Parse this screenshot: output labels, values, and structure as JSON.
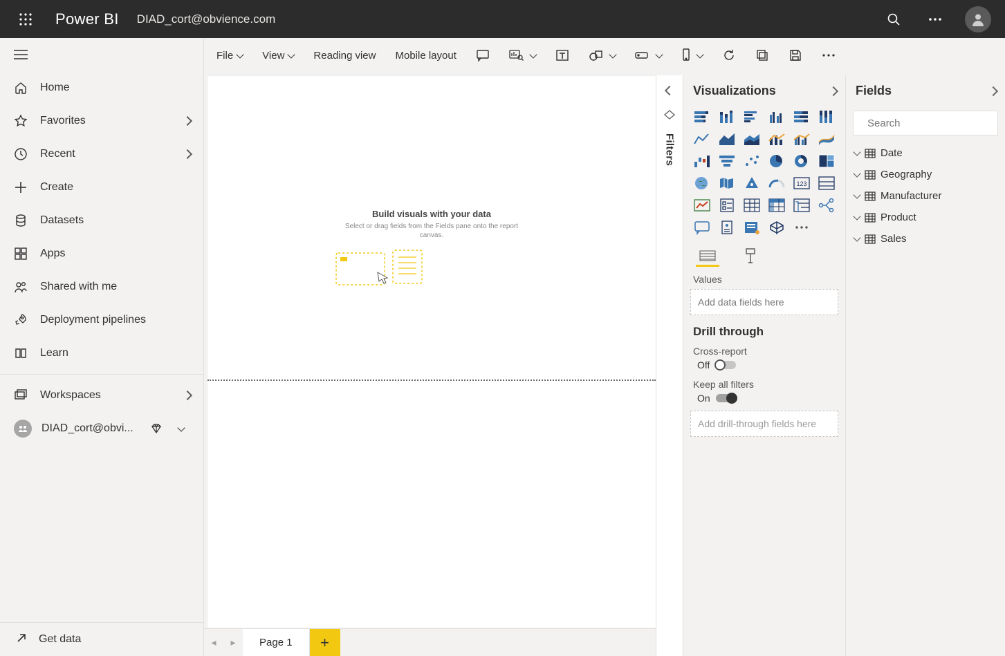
{
  "top": {
    "brand": "Power BI",
    "email": "DIAD_cort@obvience.com"
  },
  "nav": {
    "items": [
      {
        "icon": "home",
        "label": "Home",
        "expand": false
      },
      {
        "icon": "star",
        "label": "Favorites",
        "expand": true
      },
      {
        "icon": "clock",
        "label": "Recent",
        "expand": true
      },
      {
        "icon": "plus",
        "label": "Create",
        "expand": false
      },
      {
        "icon": "db",
        "label": "Datasets",
        "expand": false
      },
      {
        "icon": "apps",
        "label": "Apps",
        "expand": false
      },
      {
        "icon": "shared",
        "label": "Shared with me",
        "expand": false
      },
      {
        "icon": "rocket",
        "label": "Deployment pipelines",
        "expand": false
      },
      {
        "icon": "book",
        "label": "Learn",
        "expand": false
      }
    ],
    "workspaces": "Workspaces",
    "current_ws": "DIAD_cort@obvi...",
    "getdata": "Get data"
  },
  "ribbon": {
    "file": "File",
    "view": "View",
    "reading": "Reading view",
    "mobile": "Mobile layout"
  },
  "canvas": {
    "title": "Build visuals with your data",
    "subtitle": "Select or drag fields from the Fields pane onto the report canvas."
  },
  "tabs": {
    "page": "Page 1"
  },
  "filters": {
    "label": "Filters"
  },
  "viz": {
    "title": "Visualizations",
    "values": "Values",
    "values_ph": "Add data fields here",
    "drill": "Drill through",
    "cross": "Cross-report",
    "cross_state": "Off",
    "keep": "Keep all filters",
    "keep_state": "On",
    "drill_ph": "Add drill-through fields here"
  },
  "fields": {
    "title": "Fields",
    "search_ph": "Search",
    "tables": [
      "Date",
      "Geography",
      "Manufacturer",
      "Product",
      "Sales"
    ]
  }
}
